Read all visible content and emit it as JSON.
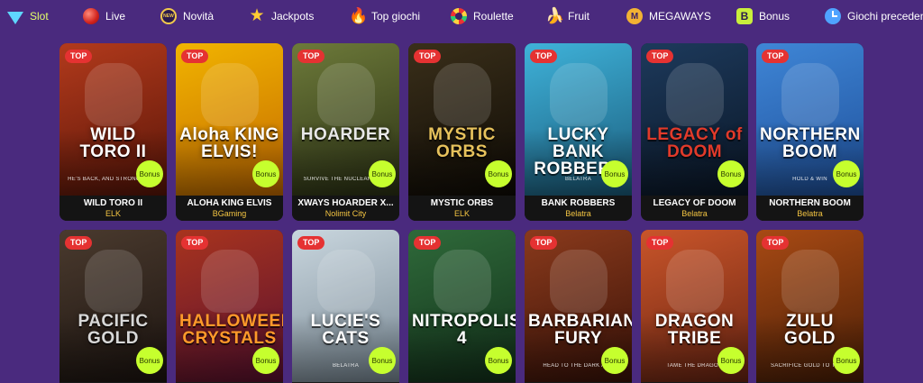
{
  "nav": [
    {
      "label": "Slot",
      "icon": "gem-icon",
      "active": true
    },
    {
      "label": "Live",
      "icon": "live-ball-icon"
    },
    {
      "label": "Novità",
      "icon": "new-badge-icon",
      "icon_text": "NEW"
    },
    {
      "label": "Jackpots",
      "icon": "star-icon"
    },
    {
      "label": "Top giochi",
      "icon": "fire-icon"
    },
    {
      "label": "Roulette",
      "icon": "roulette-icon"
    },
    {
      "label": "Fruit",
      "icon": "banana-icon"
    },
    {
      "label": "MEGAWAYS",
      "icon": "megaways-icon",
      "icon_text": "M"
    },
    {
      "label": "Bonus",
      "icon": "bonus-icon",
      "icon_text": "B"
    },
    {
      "label": "Giochi precedenti",
      "icon": "clock-icon"
    }
  ],
  "badges": {
    "top": "TOP",
    "bonus": "Bonus"
  },
  "games_row1": [
    {
      "title": "WILD TORO II",
      "provider": "ELK",
      "art_title": "WILD TORO II",
      "art_sub": "HE'S BACK, AND STRONGER T...",
      "bg": [
        "#b23a1c",
        "#5a1508"
      ],
      "title_color": "#ffffff"
    },
    {
      "title": "ALOHA KING ELVIS",
      "provider": "BGaming",
      "art_title": "Aloha KING ELVIS!",
      "art_sub": "",
      "bg": [
        "#f1b400",
        "#c46a00"
      ],
      "title_color": "#ffffff"
    },
    {
      "title": "XWAYS HOARDER X...",
      "provider": "Nolimit City",
      "art_title": "HOARDER",
      "art_sub": "SURVIVE THE NUCLEAR WA...",
      "bg": [
        "#6d7a3a",
        "#2b3114"
      ],
      "title_color": "#e8e8e8"
    },
    {
      "title": "MYSTIC ORBS",
      "provider": "ELK",
      "art_title": "MYSTIC ORBS",
      "art_sub": "",
      "bg": [
        "#3a2f1a",
        "#0f0b05"
      ],
      "title_color": "#e7c25c"
    },
    {
      "title": "BANK ROBBERS",
      "provider": "Belatra",
      "art_title": "LUCKY BANK ROBBERS",
      "art_sub": "BELATRA",
      "bg": [
        "#3fb2d9",
        "#1a5c7c"
      ],
      "title_color": "#ffffff"
    },
    {
      "title": "LEGACY OF DOOM",
      "provider": "Belatra",
      "art_title": "LEGACY of DOOM",
      "art_sub": "",
      "bg": [
        "#1d3a5c",
        "#0a1626"
      ],
      "title_color": "#e23a2a"
    },
    {
      "title": "NORTHERN BOOM",
      "provider": "Belatra",
      "art_title": "NORTHERN BOOM",
      "art_sub": "HOLD & WIN",
      "bg": [
        "#3f86d6",
        "#1e4f9a"
      ],
      "title_color": "#ffffff"
    }
  ],
  "games_row2": [
    {
      "art_title": "PACIFIC GOLD",
      "art_sub": "",
      "bg": [
        "#4a3a2e",
        "#1c1410"
      ],
      "title_color": "#d8d8d8"
    },
    {
      "art_title": "HALLOWEEN CRYSTALS",
      "art_sub": "",
      "bg": [
        "#a8341e",
        "#5a1030"
      ],
      "title_color": "#ff9a2a"
    },
    {
      "art_title": "LUCIE'S CATS",
      "art_sub": "BELATRA",
      "bg": [
        "#c9d6de",
        "#7a8a96"
      ],
      "title_color": "#ffffff"
    },
    {
      "art_title": "NITROPOLIS 4",
      "art_sub": "",
      "bg": [
        "#2f6a3a",
        "#12301a"
      ],
      "title_color": "#ffffff"
    },
    {
      "art_title": "BARBARIAN FURY",
      "art_sub": "HEAD TO THE DARK AGE",
      "bg": [
        "#8a3a1c",
        "#3a1208"
      ],
      "title_color": "#ffffff"
    },
    {
      "art_title": "DRAGON TRIBE",
      "art_sub": "TAME THE DRAGON",
      "bg": [
        "#c9552a",
        "#6a2412"
      ],
      "title_color": "#ffffff"
    },
    {
      "art_title": "ZULU GOLD",
      "art_sub": "SACRIFICE GOLD TO THEIR",
      "bg": [
        "#a84a14",
        "#4a1e06"
      ],
      "title_color": "#ffffff"
    }
  ]
}
